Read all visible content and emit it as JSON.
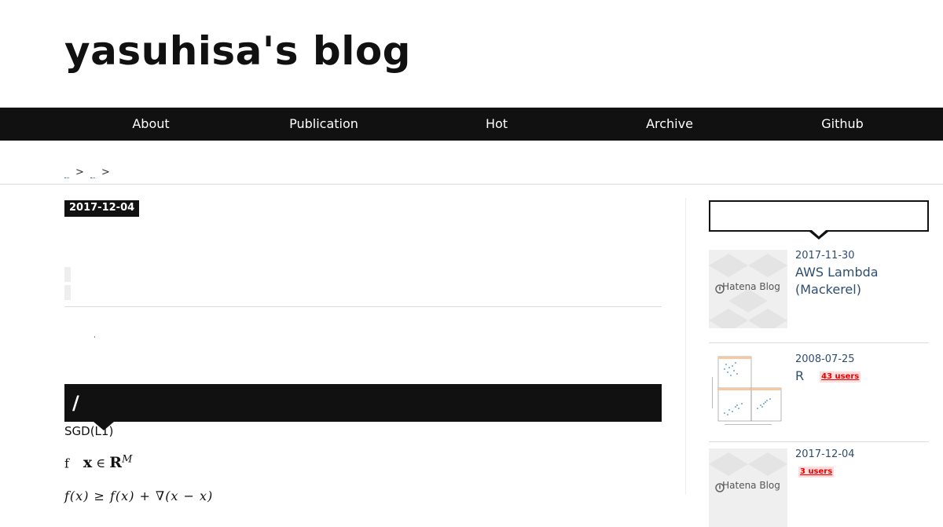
{
  "site": {
    "title": "yasuhisa's blog"
  },
  "nav": {
    "items": [
      "About",
      "Publication",
      "Hot",
      "Archive",
      "Github"
    ]
  },
  "breadcrumb": {
    "separator": ">"
  },
  "article": {
    "date": "2017-12-04",
    "section_heading": "/",
    "body_text": "SGD(L1)",
    "math_prefix": "f",
    "math_vector": "x",
    "math_in": "∈",
    "math_set": "R",
    "math_exp": "M",
    "math_line2": "f(x) ≥ f(x) + ∇(x − x)"
  },
  "sidebar": {
    "entries": [
      {
        "date": "2017-11-30",
        "title": "AWS Lambda (Mackerel)",
        "thumb": "Hatena Blog",
        "users": ""
      },
      {
        "date": "2008-07-25",
        "title": "R",
        "thumb": "scatter-plot",
        "users": "43 users"
      },
      {
        "date": "2017-12-04",
        "title": "",
        "thumb": "Hatena Blog",
        "users": "3 users"
      }
    ]
  },
  "colors": {
    "nav_bg": "#111111",
    "link": "#2e4e6e",
    "users_badge": "#ee0000",
    "users_badge_bg": "#ffdddd"
  }
}
